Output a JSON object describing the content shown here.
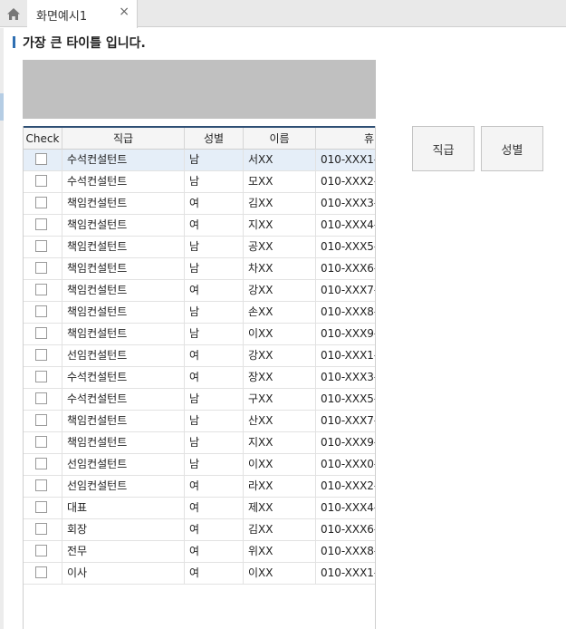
{
  "tabs": [
    {
      "label": "화면예시1",
      "close_icon": "×"
    }
  ],
  "page": {
    "title": "가장 큰 타이틀 입니다."
  },
  "grid": {
    "columns": [
      "Check",
      "직급",
      "성별",
      "이름",
      "휴"
    ],
    "rows": [
      {
        "rank": "수석컨설턴트",
        "gender": "남",
        "name": "서XX",
        "phone": "010-XXX1-"
      },
      {
        "rank": "수석컨설턴트",
        "gender": "남",
        "name": "모XX",
        "phone": "010-XXX2-"
      },
      {
        "rank": "책임컨설턴트",
        "gender": "여",
        "name": "김XX",
        "phone": "010-XXX3-"
      },
      {
        "rank": "책임컨설턴트",
        "gender": "여",
        "name": "지XX",
        "phone": "010-XXX4-"
      },
      {
        "rank": "책임컨설턴트",
        "gender": "남",
        "name": "공XX",
        "phone": "010-XXX5-"
      },
      {
        "rank": "책임컨설턴트",
        "gender": "남",
        "name": "차XX",
        "phone": "010-XXX6-"
      },
      {
        "rank": "책임컨설턴트",
        "gender": "여",
        "name": "강XX",
        "phone": "010-XXX7-"
      },
      {
        "rank": "책임컨설턴트",
        "gender": "남",
        "name": "손XX",
        "phone": "010-XXX8-"
      },
      {
        "rank": "책임컨설턴트",
        "gender": "남",
        "name": "이XX",
        "phone": "010-XXX9-"
      },
      {
        "rank": "선임컨설턴트",
        "gender": "여",
        "name": "강XX",
        "phone": "010-XXX1-"
      },
      {
        "rank": "수석컨설턴트",
        "gender": "여",
        "name": "장XX",
        "phone": "010-XXX3-"
      },
      {
        "rank": "수석컨설턴트",
        "gender": "남",
        "name": "구XX",
        "phone": "010-XXX5-"
      },
      {
        "rank": "책임컨설턴트",
        "gender": "남",
        "name": "산XX",
        "phone": "010-XXX7-"
      },
      {
        "rank": "책임컨설턴트",
        "gender": "남",
        "name": "지XX",
        "phone": "010-XXX9-"
      },
      {
        "rank": "선임컨설턴트",
        "gender": "남",
        "name": "이XX",
        "phone": "010-XXX0-"
      },
      {
        "rank": "선임컨설턴트",
        "gender": "여",
        "name": "라XX",
        "phone": "010-XXX2-"
      },
      {
        "rank": "대표",
        "gender": "여",
        "name": "제XX",
        "phone": "010-XXX4-"
      },
      {
        "rank": "회장",
        "gender": "여",
        "name": "김XX",
        "phone": "010-XXX6-"
      },
      {
        "rank": "전무",
        "gender": "여",
        "name": "위XX",
        "phone": "010-XXX8-"
      },
      {
        "rank": "이사",
        "gender": "여",
        "name": "이XX",
        "phone": "010-XXX1-"
      }
    ]
  },
  "buttons": {
    "rank_label": "직급",
    "gender_label": "성별"
  }
}
